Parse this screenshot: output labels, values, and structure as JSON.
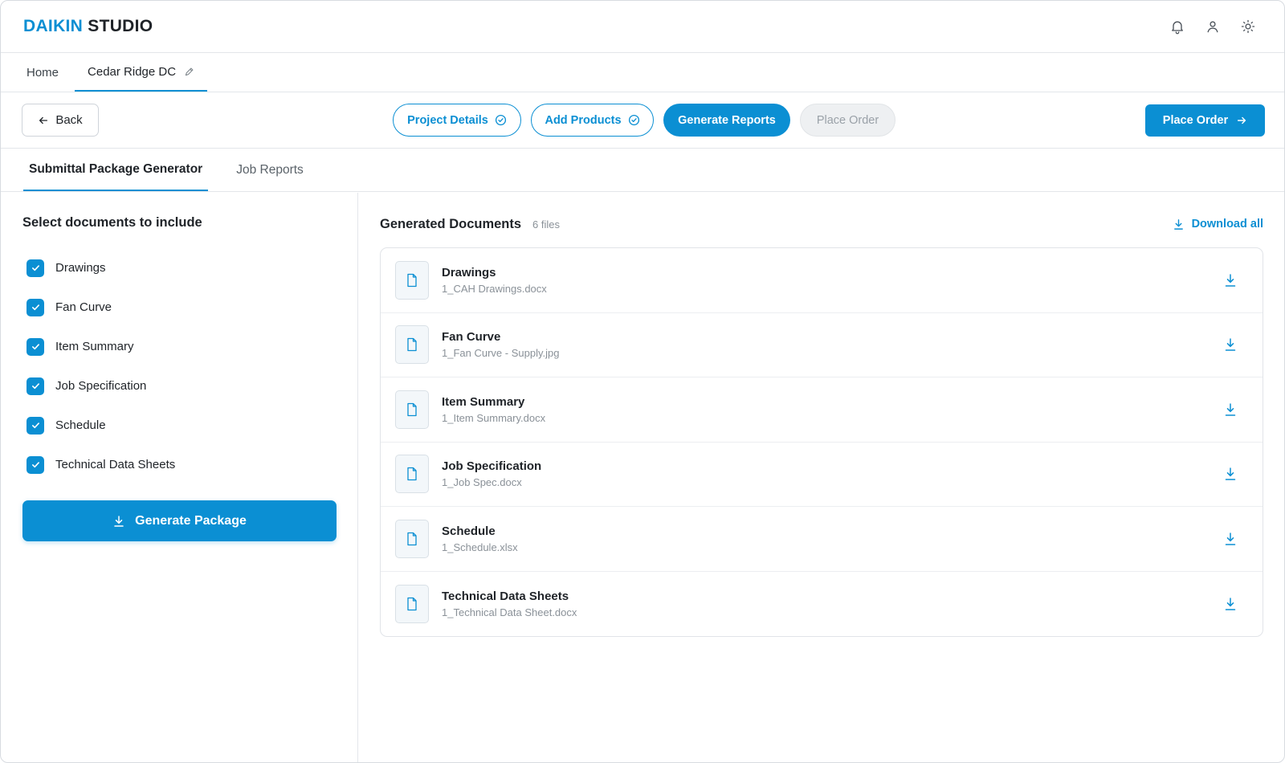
{
  "app": {
    "brand": "DAIKIN",
    "product": "STUDIO"
  },
  "project_tabs": [
    {
      "label": "Home"
    },
    {
      "label": "Cedar Ridge DC"
    }
  ],
  "stepbar": {
    "back_label": "Back",
    "steps": [
      {
        "label": "Project Details",
        "state": "done"
      },
      {
        "label": "Add Products",
        "state": "done"
      },
      {
        "label": "Generate Reports",
        "state": "current"
      },
      {
        "label": "Place Order",
        "state": "disabled"
      }
    ],
    "primary_label": "Place Order"
  },
  "subtabs": [
    {
      "label": "Submittal Package Generator"
    },
    {
      "label": "Job Reports"
    }
  ],
  "left": {
    "title": "Select documents to include",
    "options": [
      {
        "label": "Drawings",
        "checked": true
      },
      {
        "label": "Fan Curve",
        "checked": true
      },
      {
        "label": "Item Summary",
        "checked": true
      },
      {
        "label": "Job Specification",
        "checked": true
      },
      {
        "label": "Schedule",
        "checked": true
      },
      {
        "label": "Technical Data Sheets",
        "checked": true
      }
    ],
    "generate_label": "Generate Package"
  },
  "right": {
    "title": "Generated Documents",
    "count": "6 files",
    "download_all_label": "Download all",
    "documents": [
      {
        "name": "Drawings",
        "file": "1_CAH Drawings.docx"
      },
      {
        "name": "Fan Curve",
        "file": "1_Fan Curve - Supply.jpg"
      },
      {
        "name": "Item Summary",
        "file": "1_Item Summary.docx"
      },
      {
        "name": "Job Specification",
        "file": "1_Job Spec.docx"
      },
      {
        "name": "Schedule",
        "file": "1_Schedule.xlsx"
      },
      {
        "name": "Technical Data Sheets",
        "file": "1_Technical Data Sheet.docx"
      }
    ]
  },
  "colors": {
    "accent": "#0b8fd3",
    "border": "#e3e6ea",
    "muted_text": "#8a9198"
  }
}
